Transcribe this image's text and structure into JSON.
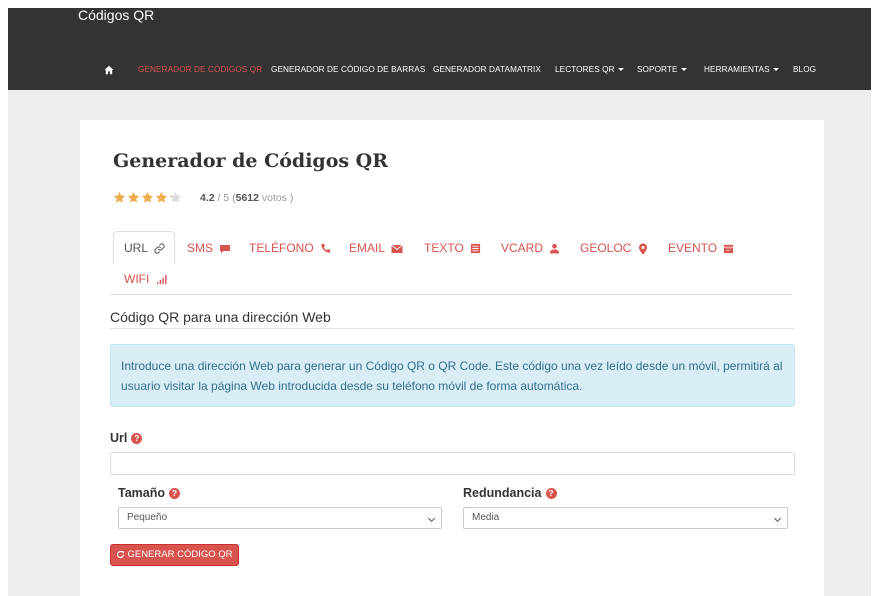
{
  "header": {
    "brand": "Códigos QR",
    "nav": [
      {
        "label": "GENERADOR DE CÓDIGOS QR",
        "active": true
      },
      {
        "label": "GENERADOR DE CÓDIGO DE BARRAS"
      },
      {
        "label": "GENERADOR DATAMATRIX"
      },
      {
        "label": "LECTORES QR",
        "dropdown": true
      },
      {
        "label": "SOPORTE",
        "dropdown": true
      },
      {
        "label": "HERRAMIENTAS",
        "dropdown": true
      },
      {
        "label": "BLOG"
      }
    ]
  },
  "main": {
    "title": "Generador de Códigos QR",
    "rating": {
      "stars": 4.2,
      "value": "4.2",
      "separator": " / 5 (",
      "votes": "5612",
      "votes_suffix": " votos )"
    },
    "tabs": [
      {
        "label": "URL",
        "icon": "link-icon",
        "active": true
      },
      {
        "label": "SMS",
        "icon": "comment-icon"
      },
      {
        "label": "TELÉFONO",
        "icon": "phone-icon"
      },
      {
        "label": "EMAIL",
        "icon": "envelope-icon"
      },
      {
        "label": "TEXTO",
        "icon": "list-icon"
      },
      {
        "label": "VCARD",
        "icon": "user-icon"
      },
      {
        "label": "GEOLOC",
        "icon": "map-marker-icon"
      },
      {
        "label": "EVENTO",
        "icon": "calendar-icon"
      },
      {
        "label": "WIFI",
        "icon": "signal-icon"
      }
    ],
    "section_title": "Código QR para una dirección Web",
    "info_text": "Introduce una dirección Web para generar un Código QR o QR Code. Este código una vez leído desde un móvil, permitirá al usuario visitar la página Web introducida desde su teléfono móvil de forma automática.",
    "form": {
      "url_label": "Url",
      "url_value": "",
      "size_label": "Tamaño",
      "size_value": "Pequeño",
      "redundancy_label": "Redundancia",
      "redundancy_value": "Media",
      "help_glyph": "?",
      "generate_button": "GENERAR CÓDIGO QR"
    }
  },
  "colors": {
    "accent": "#d9534f",
    "navbar": "#333333",
    "info_bg": "#d9edf7",
    "info_text": "#31708f",
    "star": "#f0ad4e"
  }
}
